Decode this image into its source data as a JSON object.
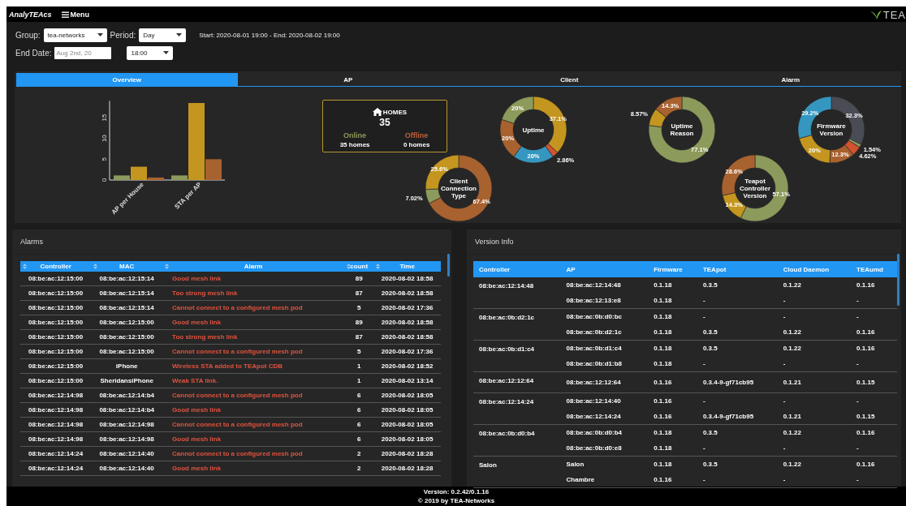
{
  "topbar": {
    "brand": "AnalyTEAcs",
    "menu": "Menu",
    "logo": "TEA"
  },
  "filters": {
    "group_label": "Group:",
    "group": "tea-networks",
    "period_label": "Period:",
    "period": "Day",
    "range": "Start: 2020-08-01 19:00 - End: 2020-08-02 19:00",
    "end_date_label": "End Date:",
    "end_date": "Aug 2nd, 20",
    "end_time": "18:00"
  },
  "tabs": [
    {
      "label": "Overview",
      "selected": true
    },
    {
      "label": "AP",
      "selected": false
    },
    {
      "label": "Client",
      "selected": false
    },
    {
      "label": "Alarm",
      "selected": false
    }
  ],
  "overview": {
    "bar_chart": {
      "chart_data": {
        "type": "bar",
        "categories": [
          "AP per House",
          "STA per AP"
        ],
        "yticks": [
          0,
          5,
          10,
          15
        ],
        "ylim": [
          0,
          19
        ],
        "series": [
          {
            "color": "#8c9a5b",
            "values": [
              1.1,
              1.1
            ]
          },
          {
            "color": "#c4961f",
            "values": [
              3.2,
              18.5
            ]
          },
          {
            "color": "#a8622f",
            "values": [
              0.6,
              5.0
            ]
          }
        ]
      }
    },
    "homes": {
      "title": "HOMES",
      "total": "35",
      "stats": [
        {
          "label": "Online",
          "value": "35 homes",
          "color": "#8c9a5b"
        },
        {
          "label": "Offline",
          "value": "0 homes",
          "color": "#c0603a"
        }
      ]
    },
    "donuts": [
      {
        "chart_data": {
          "type": "donut",
          "title": "Uptime",
          "value_labels": [
            "37.1%",
            "2.86%",
            "20%",
            "20%",
            "20%"
          ],
          "series": [
            {
              "values": [
                37.1,
                2.86,
                20,
                20,
                20
              ],
              "colors": [
                "#c4961f",
                "#d35230",
                "#3597c0",
                "#a8622f",
                "#8c9a5b"
              ]
            }
          ]
        }
      },
      {
        "chart_data": {
          "type": "donut",
          "title": "Uptime Reason",
          "value_labels": [
            "77.1%",
            "8.57%",
            "14.3%"
          ],
          "series": [
            {
              "values": [
                77.1,
                8.57,
                14.3
              ],
              "colors": [
                "#8c9a5b",
                "#c4961f",
                "#a8622f"
              ]
            }
          ]
        }
      },
      {
        "chart_data": {
          "type": "donut",
          "title": "Firmware Version",
          "value_labels": [
            "32.3%",
            "1.54%",
            "4.62%",
            "12.3%",
            "20%",
            "29.2%"
          ],
          "series": [
            {
              "values": [
                32.3,
                1.54,
                4.62,
                12.3,
                20,
                29.2
              ],
              "colors": [
                "#4a4c55",
                "#8c9a5b",
                "#d35230",
                "#a8622f",
                "#c4961f",
                "#3597c0"
              ]
            }
          ]
        }
      },
      {
        "chart_data": {
          "type": "donut",
          "title": "Client Connection Type",
          "value_labels": [
            "67.4%",
            "7.02%",
            "25.6%"
          ],
          "series": [
            {
              "values": [
                67.4,
                7.02,
                25.6
              ],
              "colors": [
                "#a8622f",
                "#8c9a5b",
                "#c4961f"
              ]
            }
          ]
        }
      },
      {
        "chart_data": {
          "type": "donut",
          "title": "Teapot Controller Version",
          "value_labels": [
            "57.1%",
            "14.3%",
            "28.6%"
          ],
          "series": [
            {
              "values": [
                57.1,
                14.3,
                28.6
              ],
              "colors": [
                "#8c9a5b",
                "#c4961f",
                "#a8622f"
              ]
            }
          ]
        }
      }
    ]
  },
  "alarms": {
    "title": "Alarms",
    "columns": [
      "Controller",
      "MAC",
      "Alarm",
      "count",
      "Time"
    ],
    "rows": [
      [
        "08:be:ac:12:15:00",
        "08:be:ac:12:15:14",
        "Good mesh link",
        "89",
        "2020-08-02 18:58"
      ],
      [
        "08:be:ac:12:15:00",
        "08:be:ac:12:15:14",
        "Too strong mesh link",
        "87",
        "2020-08-02 18:58"
      ],
      [
        "08:be:ac:12:15:00",
        "08:be:ac:12:15:14",
        "Cannot connect to a configured mesh pod",
        "5",
        "2020-08-02 17:36"
      ],
      [
        "08:be:ac:12:15:00",
        "08:be:ac:12:15:00",
        "Good mesh link",
        "89",
        "2020-08-02 18:58"
      ],
      [
        "08:be:ac:12:15:00",
        "08:be:ac:12:15:00",
        "Too strong mesh link",
        "87",
        "2020-08-02 18:58"
      ],
      [
        "08:be:ac:12:15:00",
        "08:be:ac:12:15:00",
        "Cannot connect to a configured mesh pod",
        "5",
        "2020-08-02 17:36"
      ],
      [
        "08:be:ac:12:15:00",
        "iPhone",
        "Wireless STA added to TEApot CDB",
        "1",
        "2020-08-02 18:52"
      ],
      [
        "08:be:ac:12:15:00",
        "SheridansiPhone",
        "Weak STA link.",
        "1",
        "2020-08-02 13:14"
      ],
      [
        "08:be:ac:12:14:98",
        "08:be:ac:12:14:b4",
        "Cannot connect to a configured mesh pod",
        "6",
        "2020-08-02 18:05"
      ],
      [
        "08:be:ac:12:14:98",
        "08:be:ac:12:14:b4",
        "Good mesh link",
        "6",
        "2020-08-02 18:05"
      ],
      [
        "08:be:ac:12:14:98",
        "08:be:ac:12:14:98",
        "Cannot connect to a configured mesh pod",
        "6",
        "2020-08-02 18:05"
      ],
      [
        "08:be:ac:12:14:98",
        "08:be:ac:12:14:98",
        "Good mesh link",
        "6",
        "2020-08-02 18:05"
      ],
      [
        "08:be:ac:12:14:24",
        "08:be:ac:12:14:40",
        "Cannot connect to a configured mesh pod",
        "2",
        "2020-08-02 18:28"
      ],
      [
        "08:be:ac:12:14:24",
        "08:be:ac:12:14:40",
        "Good mesh link",
        "2",
        "2020-08-02 18:28"
      ]
    ]
  },
  "versions": {
    "title": "Version Info",
    "columns": [
      "Controller",
      "AP",
      "Firmware",
      "TEApot",
      "Cloud Daemon",
      "TEAumd"
    ],
    "groups": [
      {
        "controller": "08:be:ac:12:14:48",
        "aps": [
          [
            "08:be:ac:12:14:48",
            "0.1.18",
            "0.3.5",
            "0.1.22",
            "0.1.16"
          ],
          [
            "08:be:ac:12:13:e8",
            "0.1.18",
            "-",
            "-",
            "-"
          ]
        ]
      },
      {
        "controller": "08:be:ac:0b:d2:1c",
        "aps": [
          [
            "08:be:ac:0b:d0:bc",
            "0.1.18",
            "-",
            "-",
            "-"
          ],
          [
            "08:be:ac:0b:d2:1c",
            "0.1.18",
            "0.3.5",
            "0.1.22",
            "0.1.16"
          ]
        ]
      },
      {
        "controller": "08:be:ac:0b:d1:c4",
        "aps": [
          [
            "08:be:ac:0b:d1:c4",
            "0.1.18",
            "0.3.5",
            "0.1.22",
            "0.1.16"
          ],
          [
            "08:be:ac:0b:d1:b8",
            "0.1.18",
            "-",
            "-",
            "-"
          ]
        ]
      },
      {
        "controller": "08:be:ac:12:12:64",
        "aps": [
          [
            "08:be:ac:12:12:64",
            "0.1.16",
            "0.3.4-9-gf71cb95",
            "0.1.21",
            "0.1.15"
          ]
        ]
      },
      {
        "controller": "08:be:ac:12:14:24",
        "aps": [
          [
            "08:be:ac:12:14:40",
            "0.1.16",
            "-",
            "-",
            "-"
          ],
          [
            "08:be:ac:12:14:24",
            "0.1.16",
            "0.3.4-9-gf71cb95",
            "0.1.21",
            "0.1.15"
          ]
        ]
      },
      {
        "controller": "08:be:ac:0b:d0:b4",
        "aps": [
          [
            "08:be:ac:0b:d0:b4",
            "0.1.18",
            "0.3.5",
            "0.1.22",
            "0.1.16"
          ],
          [
            "08:be:ac:0b:d0:e8",
            "0.1.18",
            "-",
            "-",
            "-"
          ]
        ]
      },
      {
        "controller": "Salon",
        "aps": [
          [
            "Salon",
            "0.1.18",
            "0.3.5",
            "0.1.22",
            "0.1.16"
          ],
          [
            "Chambre",
            "0.1.16",
            "-",
            "-",
            "-"
          ]
        ]
      }
    ]
  },
  "footer": {
    "version": "Version: 0.2.42/0.1.16",
    "copyright": "© 2019 by TEA-Networks"
  }
}
